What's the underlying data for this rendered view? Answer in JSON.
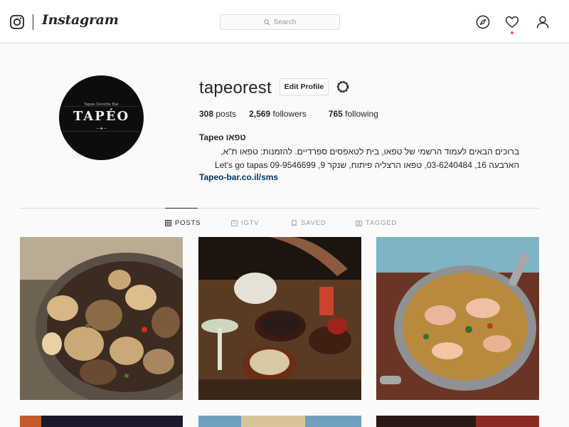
{
  "nav": {
    "brand": "Instagram",
    "search_placeholder": "Search",
    "accent_color": "#ed4956"
  },
  "profile": {
    "avatar": {
      "subtitle": "Tapas·Ceviche Bar",
      "title": "TAPÉO"
    },
    "username": "tapeorest",
    "edit_profile_label": "Edit Profile",
    "stats": {
      "posts_count": "308",
      "posts_label": "posts",
      "followers_count": "2,569",
      "followers_label": "followers",
      "following_count": "765",
      "following_label": "following"
    },
    "full_name": "Tapeo טפאו",
    "bio_lines": [
      "ברוכים הבאים לעמוד הרשמי של טפאו, בית לטאפסים ספרדיים. להזמנות: טפאו ת\"א,",
      "הארבעה 16, 03-6240484, טפאו הרצליה פיתוח, שנקר 9, 09-9546699 Let's go tapas"
    ],
    "website": "Tapeo-bar.co.il/sms"
  },
  "tabs": [
    {
      "label": "POSTS",
      "icon": "grid-icon",
      "active": true
    },
    {
      "label": "IGTV",
      "icon": "tv-icon",
      "active": false
    },
    {
      "label": "SAVED",
      "icon": "bookmark-icon",
      "active": false
    },
    {
      "label": "TAGGED",
      "icon": "tag-icon",
      "active": false
    }
  ]
}
